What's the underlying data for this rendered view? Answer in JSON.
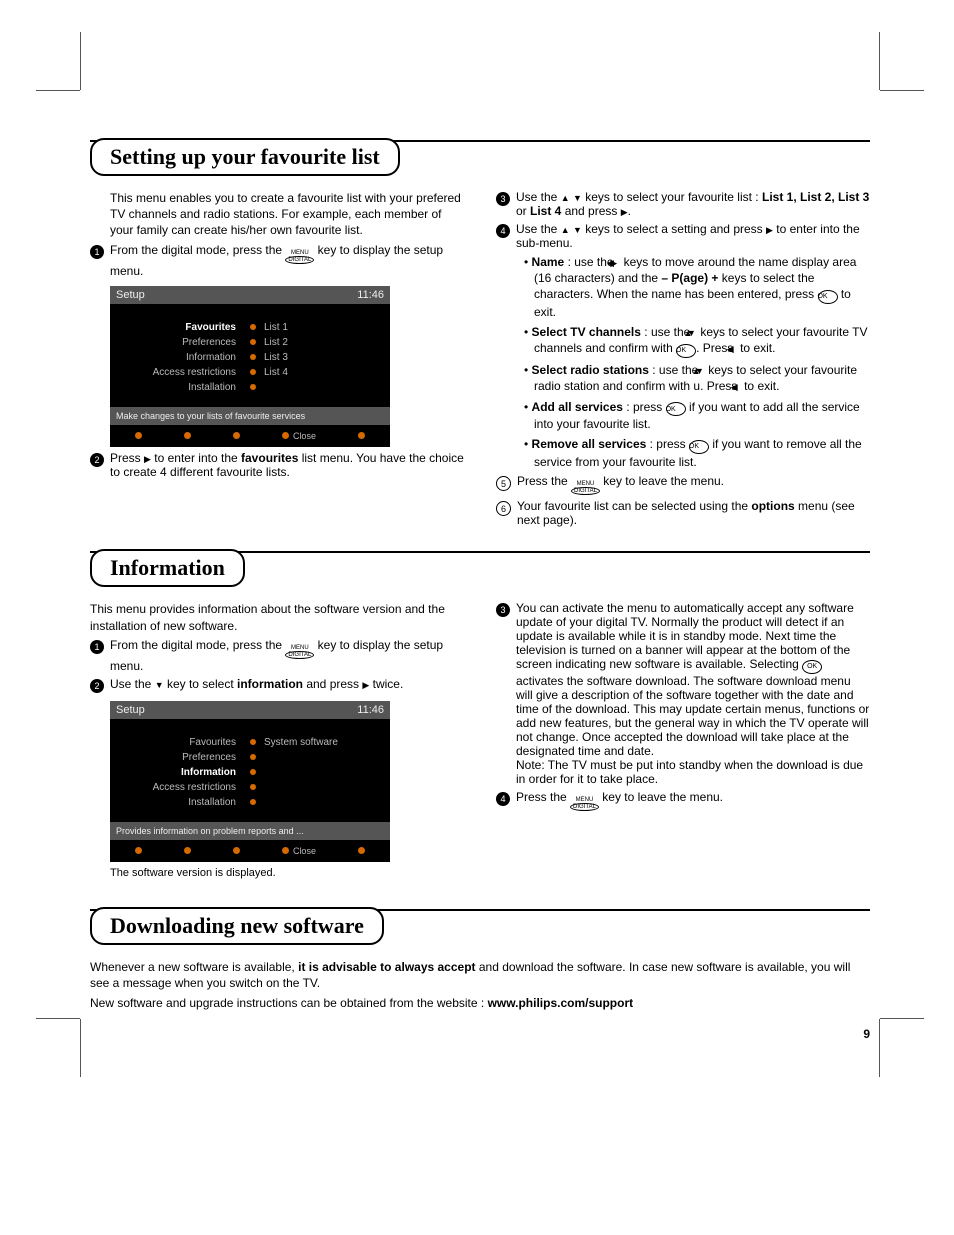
{
  "page_number": "9",
  "sections": {
    "fav": {
      "title": "Setting up your favourite list",
      "intro": "This menu enables you to create a favourite list with your prefered TV channels and radio stations. For example, each member of your family can create his/her own favourite list.",
      "step1": "From the digital mode, press the",
      "step1b": "key to display the setup menu.",
      "step2a": "Press ",
      "step2b": " to enter into the ",
      "step2c": "favourites",
      "step2d": " list menu. You have the choice to create 4 different favourite lists.",
      "step3a": "Use the ",
      "step3b": " keys to select your favourite list : ",
      "step3c": "List 1, List 2, List 3",
      "step3d": " or ",
      "step3e": "List 4",
      "step3f": " and press ",
      "step4a": "Use the ",
      "step4b": " keys to select a setting and press ",
      "step4c": " to enter into the sub-menu.",
      "bullet_name_a": "Name",
      "bullet_name_b": " : use the ",
      "bullet_name_c": " keys to move around the name display area (16 characters) and the ",
      "bullet_name_d": "– P(age) +",
      "bullet_name_e": " keys to select the characters. When the name has been entered, press ",
      "bullet_name_f": " to exit.",
      "bullet_tv_a": "Select TV channels",
      "bullet_tv_b": " : use the ",
      "bullet_tv_c": " keys to select your favourite TV channels and confirm with ",
      "bullet_tv_d": ". Press ",
      "bullet_tv_e": " to exit.",
      "bullet_radio_a": "Select radio stations",
      "bullet_radio_b": " : use the ",
      "bullet_radio_c": " keys to select your favourite radio station and confirm with u. Press ",
      "bullet_radio_d": " to exit.",
      "bullet_add_a": "Add all services",
      "bullet_add_b": " : press ",
      "bullet_add_c": " if you want to add all the service into your favourite list.",
      "bullet_rem_a": "Remove all services",
      "bullet_rem_b": " : press ",
      "bullet_rem_c": " if you want to remove all the service from your favourite list.",
      "step5a": "Press the ",
      "step5b": " key to leave the menu.",
      "step6a": "Your favourite list can be selected using the ",
      "step6b": "options",
      "step6c": " menu (see next page)."
    },
    "info": {
      "title": "Information",
      "intro": "This menu provides information about the software version and the installation of new software.",
      "step1": "From the digital mode, press the",
      "step1b": "key to display the setup menu.",
      "step2a": "Use the ",
      "step2b": " key to select ",
      "step2c": "information",
      "step2d": " and press ",
      "step2e": " twice.",
      "caption": "The software version is displayed.",
      "step3": "You can activate the menu to automatically accept any software update of your digital TV. Normally the product will detect if an update is available while it is in standby mode. Next time the television is turned on a banner will appear at the bottom of the screen indicating new software is available. Selecting ",
      "step3b": " activates the software download.  The software download menu will give a description of the software together with the date and time of the download.  This may update certain menus, functions or add new features, but the general way in which the TV operate will not change. Once accepted the download will take place at the designated time and date.",
      "step3note": "Note: The TV must be put into standby when the download is due in order for it to take place.",
      "step4a": "Press the ",
      "step4b": " key to leave the menu."
    },
    "dl": {
      "title": "Downloading new software",
      "p1a": "Whenever a new software is available, ",
      "p1b": "it is advisable to always accept",
      "p1c": " and download the software. In case new software is available, you will see a message when you switch on the TV.",
      "p2a": "New software and upgrade instructions can be obtained from the website : ",
      "p2b": "www.philips.com/support"
    }
  },
  "screen1": {
    "title": "Setup",
    "time": "11:46",
    "rows": [
      {
        "left": "Favourites",
        "bold": true,
        "right": "List 1"
      },
      {
        "left": "Preferences",
        "bold": false,
        "right": "List 2"
      },
      {
        "left": "Information",
        "bold": false,
        "right": "List 3"
      },
      {
        "left": "Access restrictions",
        "bold": false,
        "right": "List 4"
      },
      {
        "left": "Installation",
        "bold": false,
        "right": ""
      }
    ],
    "hint": "Make changes to your lists of favourite services",
    "close": "Close"
  },
  "screen2": {
    "title": "Setup",
    "time": "11:46",
    "rows": [
      {
        "left": "Favourites",
        "bold": false,
        "right": "System software"
      },
      {
        "left": "Preferences",
        "bold": false,
        "right": ""
      },
      {
        "left": "Information",
        "bold": true,
        "right": ""
      },
      {
        "left": "Access restrictions",
        "bold": false,
        "right": ""
      },
      {
        "left": "Installation",
        "bold": false,
        "right": ""
      }
    ],
    "hint": "Provides information on problem reports and ...",
    "close": "Close"
  },
  "glyphs": {
    "menu_top": "MENU",
    "menu_oval": "DIGITAL",
    "ok": "OK"
  }
}
